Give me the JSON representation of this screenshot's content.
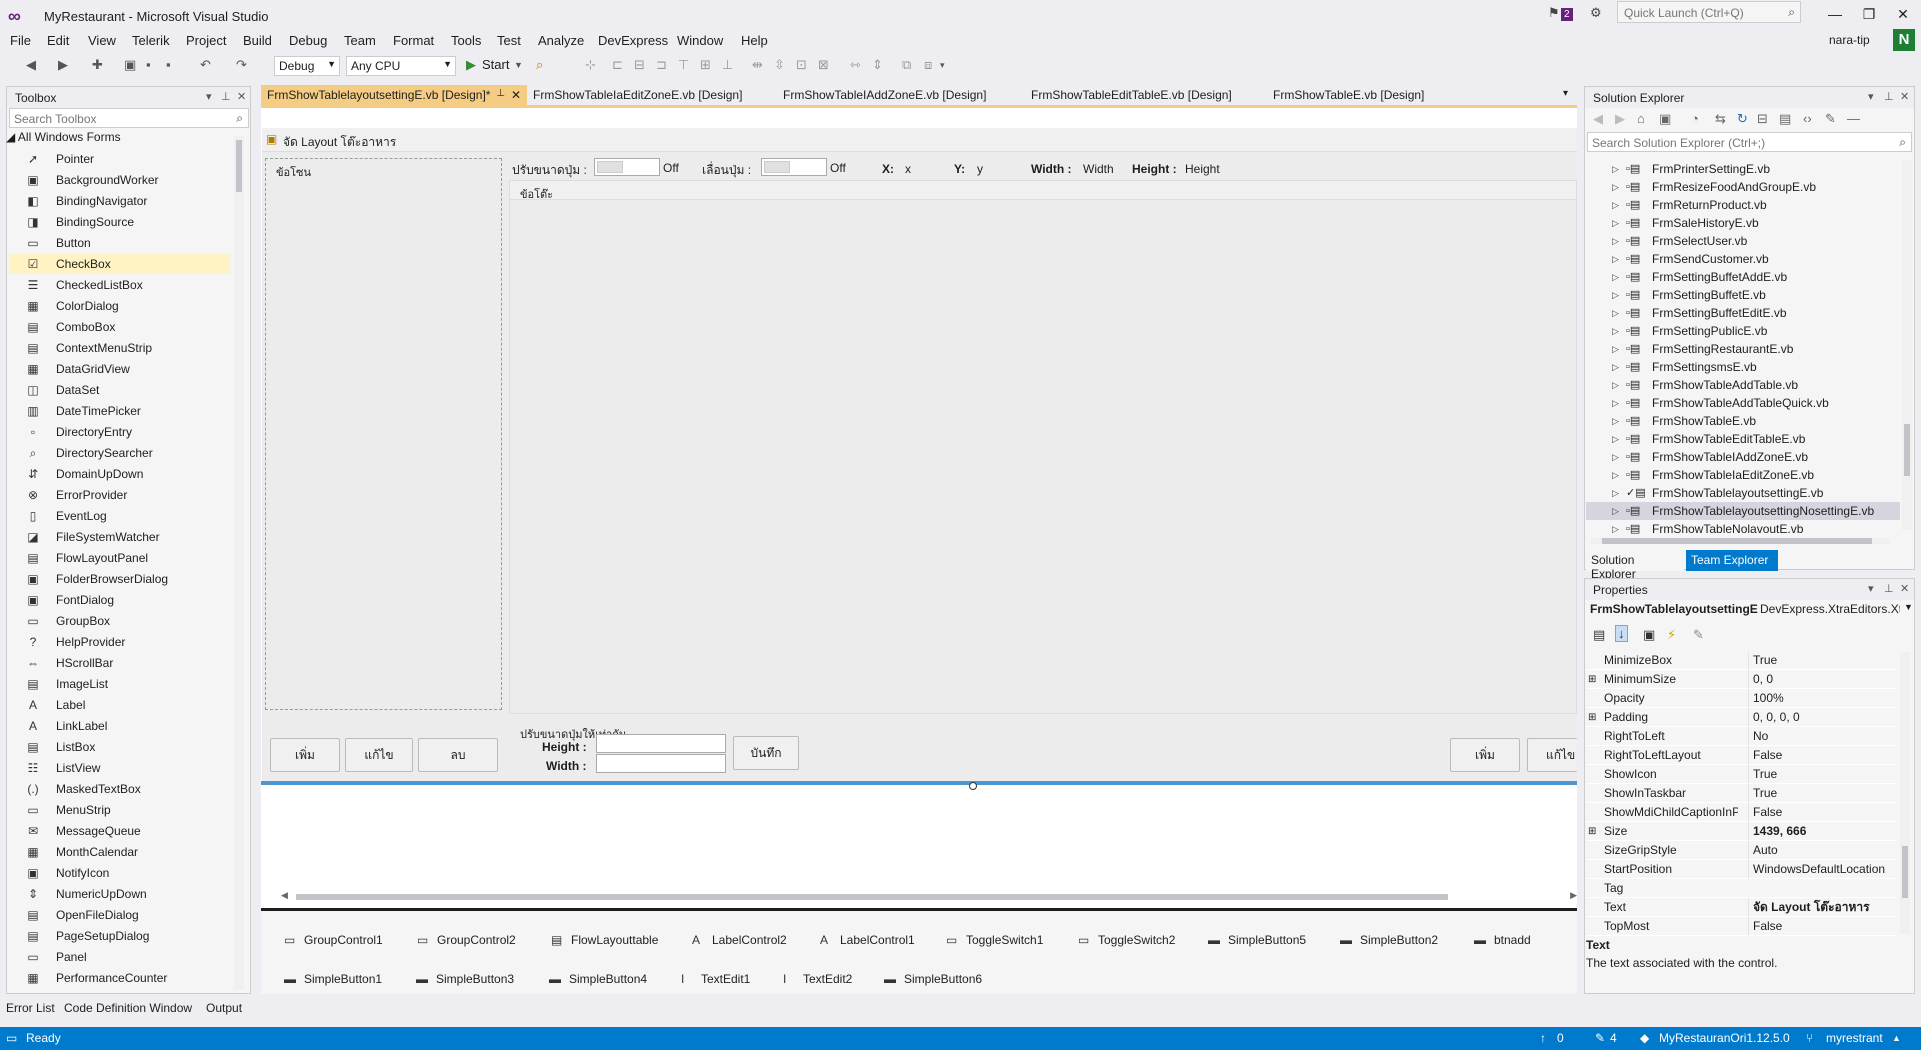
{
  "window": {
    "title": "MyRestaurant - Microsoft Visual Studio",
    "notification_count": "2",
    "quick_launch_placeholder": "Quick Launch (Ctrl+Q)",
    "user": "nara-tip",
    "user_initial": "N"
  },
  "menu": [
    "File",
    "Edit",
    "View",
    "Telerik",
    "Project",
    "Build",
    "Debug",
    "Team",
    "Format",
    "Tools",
    "Test",
    "Analyze",
    "DevExpress",
    "Window",
    "Help"
  ],
  "toolbar": {
    "config": "Debug",
    "platform": "Any CPU",
    "start_label": "Start"
  },
  "toolbox": {
    "title": "Toolbox",
    "search_placeholder": "Search Toolbox",
    "category": "All Windows Forms",
    "items": [
      {
        "label": "Pointer",
        "icon": "pointer-icon",
        "glyph": "➚"
      },
      {
        "label": "BackgroundWorker",
        "icon": "background-worker-icon",
        "glyph": "▣"
      },
      {
        "label": "BindingNavigator",
        "icon": "binding-navigator-icon",
        "glyph": "◧"
      },
      {
        "label": "BindingSource",
        "icon": "binding-source-icon",
        "glyph": "◨"
      },
      {
        "label": "Button",
        "icon": "button-icon",
        "glyph": "▭"
      },
      {
        "label": "CheckBox",
        "icon": "checkbox-icon",
        "glyph": "☑"
      },
      {
        "label": "CheckedListBox",
        "icon": "checked-list-box-icon",
        "glyph": "☰"
      },
      {
        "label": "ColorDialog",
        "icon": "color-dialog-icon",
        "glyph": "▦"
      },
      {
        "label": "ComboBox",
        "icon": "combobox-icon",
        "glyph": "▤"
      },
      {
        "label": "ContextMenuStrip",
        "icon": "context-menu-strip-icon",
        "glyph": "▤"
      },
      {
        "label": "DataGridView",
        "icon": "data-grid-view-icon",
        "glyph": "▦"
      },
      {
        "label": "DataSet",
        "icon": "dataset-icon",
        "glyph": "◫"
      },
      {
        "label": "DateTimePicker",
        "icon": "date-time-picker-icon",
        "glyph": "▥"
      },
      {
        "label": "DirectoryEntry",
        "icon": "directory-entry-icon",
        "glyph": "▫"
      },
      {
        "label": "DirectorySearcher",
        "icon": "directory-searcher-icon",
        "glyph": "⌕"
      },
      {
        "label": "DomainUpDown",
        "icon": "domain-up-down-icon",
        "glyph": "⇵"
      },
      {
        "label": "ErrorProvider",
        "icon": "error-provider-icon",
        "glyph": "⊗"
      },
      {
        "label": "EventLog",
        "icon": "event-log-icon",
        "glyph": "▯"
      },
      {
        "label": "FileSystemWatcher",
        "icon": "file-system-watcher-icon",
        "glyph": "◪"
      },
      {
        "label": "FlowLayoutPanel",
        "icon": "flow-layout-panel-icon",
        "glyph": "▤"
      },
      {
        "label": "FolderBrowserDialog",
        "icon": "folder-browser-dialog-icon",
        "glyph": "▣"
      },
      {
        "label": "FontDialog",
        "icon": "font-dialog-icon",
        "glyph": "▣"
      },
      {
        "label": "GroupBox",
        "icon": "group-box-icon",
        "glyph": "▭"
      },
      {
        "label": "HelpProvider",
        "icon": "help-provider-icon",
        "glyph": "?"
      },
      {
        "label": "HScrollBar",
        "icon": "hscrollbar-icon",
        "glyph": "⇔"
      },
      {
        "label": "ImageList",
        "icon": "image-list-icon",
        "glyph": "▤"
      },
      {
        "label": "Label",
        "icon": "label-icon",
        "glyph": "A"
      },
      {
        "label": "LinkLabel",
        "icon": "link-label-icon",
        "glyph": "A"
      },
      {
        "label": "ListBox",
        "icon": "list-box-icon",
        "glyph": "▤"
      },
      {
        "label": "ListView",
        "icon": "list-view-icon",
        "glyph": "☷"
      },
      {
        "label": "MaskedTextBox",
        "icon": "masked-text-box-icon",
        "glyph": "(.)"
      },
      {
        "label": "MenuStrip",
        "icon": "menu-strip-icon",
        "glyph": "▭"
      },
      {
        "label": "MessageQueue",
        "icon": "message-queue-icon",
        "glyph": "✉"
      },
      {
        "label": "MonthCalendar",
        "icon": "month-calendar-icon",
        "glyph": "▦"
      },
      {
        "label": "NotifyIcon",
        "icon": "notify-icon-icon",
        "glyph": "▣"
      },
      {
        "label": "NumericUpDown",
        "icon": "numeric-up-down-icon",
        "glyph": "⇕"
      },
      {
        "label": "OpenFileDialog",
        "icon": "open-file-dialog-icon",
        "glyph": "▤"
      },
      {
        "label": "PageSetupDialog",
        "icon": "page-setup-dialog-icon",
        "glyph": "▤"
      },
      {
        "label": "Panel",
        "icon": "panel-icon",
        "glyph": "▭"
      },
      {
        "label": "PerformanceCounter",
        "icon": "performance-counter-icon",
        "glyph": "▦"
      }
    ]
  },
  "doc_tabs": [
    {
      "label": "FrmShowTablelayoutsettingE.vb [Design]*",
      "active": true
    },
    {
      "label": "FrmShowTableIaEditZoneE.vb [Design]",
      "active": false
    },
    {
      "label": "FrmShowTableIAddZoneE.vb [Design]",
      "active": false
    },
    {
      "label": "FrmShowTableEditTableE.vb [Design]",
      "active": false
    },
    {
      "label": "FrmShowTableE.vb [Design]",
      "active": false
    }
  ],
  "form": {
    "title": "จัด Layout โต๊ะอาหาร",
    "zone_group": "ข้อโซน",
    "adjust_btn_label": "ปรับขนาดปุ่ม :",
    "toggle1_state": "Off",
    "move_btn_label": "เลื่อนปุ่ม :",
    "toggle2_state": "Off",
    "x_label": "X:",
    "x_value": "x",
    "y_label": "Y:",
    "y_value": "y",
    "width_label": "Width :",
    "width_value": "Width",
    "height_label": "Height :",
    "height_value": "Height",
    "table_group": "ข้อโต๊ะ",
    "btn_add": "เพิ่ม",
    "btn_edit": "แก้ไข",
    "btn_delete": "ลบ",
    "equal_group": "ปรับขนาดปุ่มให้เท่ากัน",
    "eq_height_label": "Height :",
    "eq_width_label": "Width :",
    "btn_save": "บันทึก",
    "btn_add2": "เพิ่ม",
    "btn_edit2": "แก้ไข"
  },
  "component_tray": [
    {
      "label": "GroupControl1",
      "icon": "group-control-icon",
      "glyph": "▭"
    },
    {
      "label": "GroupControl2",
      "icon": "group-control-icon",
      "glyph": "▭"
    },
    {
      "label": "FlowLayouttable",
      "icon": "flow-layout-icon",
      "glyph": "▤"
    },
    {
      "label": "LabelControl2",
      "icon": "label-control-icon",
      "glyph": "A"
    },
    {
      "label": "LabelControl1",
      "icon": "label-control-icon",
      "glyph": "A"
    },
    {
      "label": "ToggleSwitch1",
      "icon": "toggle-switch-icon",
      "glyph": "▭"
    },
    {
      "label": "ToggleSwitch2",
      "icon": "toggle-switch-icon",
      "glyph": "▭"
    },
    {
      "label": "SimpleButton5",
      "icon": "simple-button-icon",
      "glyph": "▬"
    },
    {
      "label": "SimpleButton2",
      "icon": "simple-button-icon",
      "glyph": "▬"
    },
    {
      "label": "btnadd",
      "icon": "simple-button-icon",
      "glyph": "▬"
    },
    {
      "label": "SimpleButton1",
      "icon": "simple-button-icon",
      "glyph": "▬"
    },
    {
      "label": "SimpleButton3",
      "icon": "simple-button-icon",
      "glyph": "▬"
    },
    {
      "label": "SimpleButton4",
      "icon": "simple-button-icon",
      "glyph": "▬"
    },
    {
      "label": "TextEdit1",
      "icon": "text-edit-icon",
      "glyph": "I"
    },
    {
      "label": "TextEdit2",
      "icon": "text-edit-icon",
      "glyph": "I"
    },
    {
      "label": "SimpleButton6",
      "icon": "simple-button-icon",
      "glyph": "▬"
    }
  ],
  "solution_explorer": {
    "title": "Solution Explorer",
    "search_placeholder": "Search Solution Explorer (Ctrl+;)",
    "files": [
      {
        "label": "FrmPrinterSettingE.vb",
        "checked": false
      },
      {
        "label": "FrmResizeFoodAndGroupE.vb",
        "checked": false
      },
      {
        "label": "FrmReturnProduct.vb",
        "checked": false
      },
      {
        "label": "FrmSaleHistoryE.vb",
        "checked": false
      },
      {
        "label": "FrmSelectUser.vb",
        "checked": false
      },
      {
        "label": "FrmSendCustomer.vb",
        "checked": false
      },
      {
        "label": "FrmSettingBuffetAddE.vb",
        "checked": false
      },
      {
        "label": "FrmSettingBuffetE.vb",
        "checked": false
      },
      {
        "label": "FrmSettingBuffetEditE.vb",
        "checked": false
      },
      {
        "label": "FrmSettingPublicE.vb",
        "checked": false
      },
      {
        "label": "FrmSettingRestaurantE.vb",
        "checked": false
      },
      {
        "label": "FrmSettingsmsE.vb",
        "checked": false
      },
      {
        "label": "FrmShowTableAddTable.vb",
        "checked": false
      },
      {
        "label": "FrmShowTableAddTableQuick.vb",
        "checked": false
      },
      {
        "label": "FrmShowTableE.vb",
        "checked": false
      },
      {
        "label": "FrmShowTableEditTableE.vb",
        "checked": false
      },
      {
        "label": "FrmShowTableIAddZoneE.vb",
        "checked": false
      },
      {
        "label": "FrmShowTableIaEditZoneE.vb",
        "checked": false
      },
      {
        "label": "FrmShowTablelayoutsettingE.vb",
        "checked": true
      },
      {
        "label": "FrmShowTablelayoutsettingNosettingE.vb",
        "checked": false
      },
      {
        "label": "FrmShowTableNolavoutE.vb",
        "checked": false
      }
    ],
    "tab_solution": "Solution Explorer",
    "tab_team": "Team Explorer"
  },
  "properties": {
    "title": "Properties",
    "object_name": "FrmShowTablelayoutsettingE",
    "object_type": "DevExpress.XtraEditors.Xtr…",
    "rows": [
      {
        "name": "MinimizeBox",
        "value": "True",
        "expand": "",
        "bold": false
      },
      {
        "name": "MinimumSize",
        "value": "0, 0",
        "expand": "⊞",
        "bold": false
      },
      {
        "name": "Opacity",
        "value": "100%",
        "expand": "",
        "bold": false
      },
      {
        "name": "Padding",
        "value": "0, 0, 0, 0",
        "expand": "⊞",
        "bold": false
      },
      {
        "name": "RightToLeft",
        "value": "No",
        "expand": "",
        "bold": false
      },
      {
        "name": "RightToLeftLayout",
        "value": "False",
        "expand": "",
        "bold": false
      },
      {
        "name": "ShowIcon",
        "value": "True",
        "expand": "",
        "bold": false
      },
      {
        "name": "ShowInTaskbar",
        "value": "True",
        "expand": "",
        "bold": false
      },
      {
        "name": "ShowMdiChildCaptionInPa",
        "value": "False",
        "expand": "",
        "bold": false
      },
      {
        "name": "Size",
        "value": "1439, 666",
        "expand": "⊞",
        "bold": true
      },
      {
        "name": "SizeGripStyle",
        "value": "Auto",
        "expand": "",
        "bold": false
      },
      {
        "name": "StartPosition",
        "value": "WindowsDefaultLocation",
        "expand": "",
        "bold": false
      },
      {
        "name": "Tag",
        "value": "",
        "expand": "",
        "bold": false
      },
      {
        "name": "Text",
        "value": "จัด Layout โต๊ะอาหาร",
        "expand": "",
        "bold": true
      },
      {
        "name": "TopMost",
        "value": "False",
        "expand": "",
        "bold": false
      }
    ],
    "desc_title": "Text",
    "desc_text": "The text associated with the control."
  },
  "bottom_tabs": [
    "Error List",
    "Code Definition Window",
    "Output"
  ],
  "status": {
    "ready": "Ready",
    "up_count": "0",
    "pencil_count": "4",
    "project": "MyRestauranOri1.12.5.0",
    "branch": "myrestrant"
  },
  "colors": {
    "accent": "#007acc",
    "tab_active": "#f5cc84",
    "vs_purple": "#68217a"
  }
}
